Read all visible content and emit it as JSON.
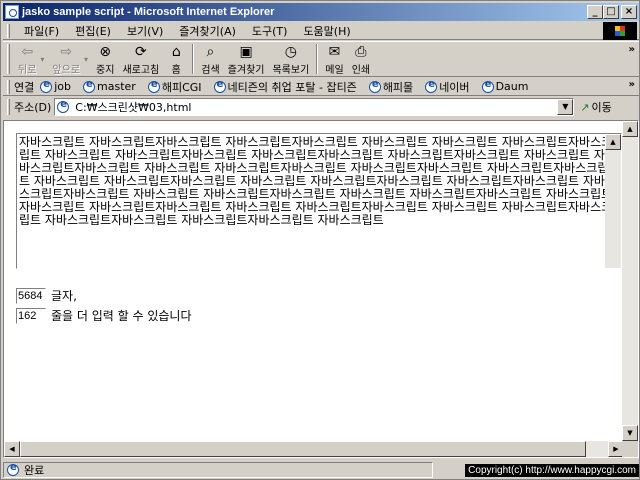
{
  "window": {
    "title": "jasko sample script - Microsoft Internet Explorer",
    "minimize": "_",
    "maximize": "□",
    "close": "×"
  },
  "menu": [
    "파일(F)",
    "편집(E)",
    "보기(V)",
    "즐겨찾기(A)",
    "도구(T)",
    "도움말(H)"
  ],
  "toolbar": {
    "back": "뒤로",
    "forward": "앞으로",
    "stop": "중지",
    "refresh": "새로고침",
    "home": "홈",
    "search": "검색",
    "favorites": "즐겨찾기",
    "history": "목록보기",
    "mail": "메일",
    "print": "인쇄",
    "more": "»"
  },
  "links": {
    "label": "연결",
    "items": [
      "job",
      "master",
      "해피CGI",
      "네티즌의 취업 포탈 - 잡티즌",
      "해피몰",
      "네이버",
      "Daum"
    ],
    "more": "»"
  },
  "address": {
    "label": "주소(D)",
    "url": "C:₩스크린샷₩03,html",
    "go": "이동"
  },
  "content": {
    "textarea_text": "자바스크립트 자바스크립트자바스크립트 자바스크립트자바스크립트 자바스크립트 자바스크립트 자바스크립트자바스크립트 자바스크립트 자바스크립트자바스크립트 자바스크립트자바스크립트 자바스크립트자바스크립트 자바스크립트 자바스크립트자바스크립트 자바스크립트 자바스크립트자바스크립트 자바스크립트자바스크립트 자바스크립트자바스크립트 자바스크립트 자바스크립트자바스크립트 자바스크립트 자바스크립트자바스크립트 자바스크립트자바스크립트 자바스크립트자바스크립트 자바스크립트 자바스크립트자바스크립트 자바스크립트 자바스크립트자바스크립트 자바스크립트자바스크립트 자바스크립트자바스크립트 자바스크립트 자바스크립트자바스크립트 자바스크립트 자바스크립트자바스크립트 자바스크립트자바스크립트 자바스크립트자바스크립트 자바스크립트",
    "char_count": "5684",
    "char_label": "글자,",
    "line_count": "162",
    "line_label": "줄을 더 입력 할 수 있습니다"
  },
  "status": {
    "text": "완료",
    "copyright": "Copyright(c) http://www.happycgi.com"
  }
}
